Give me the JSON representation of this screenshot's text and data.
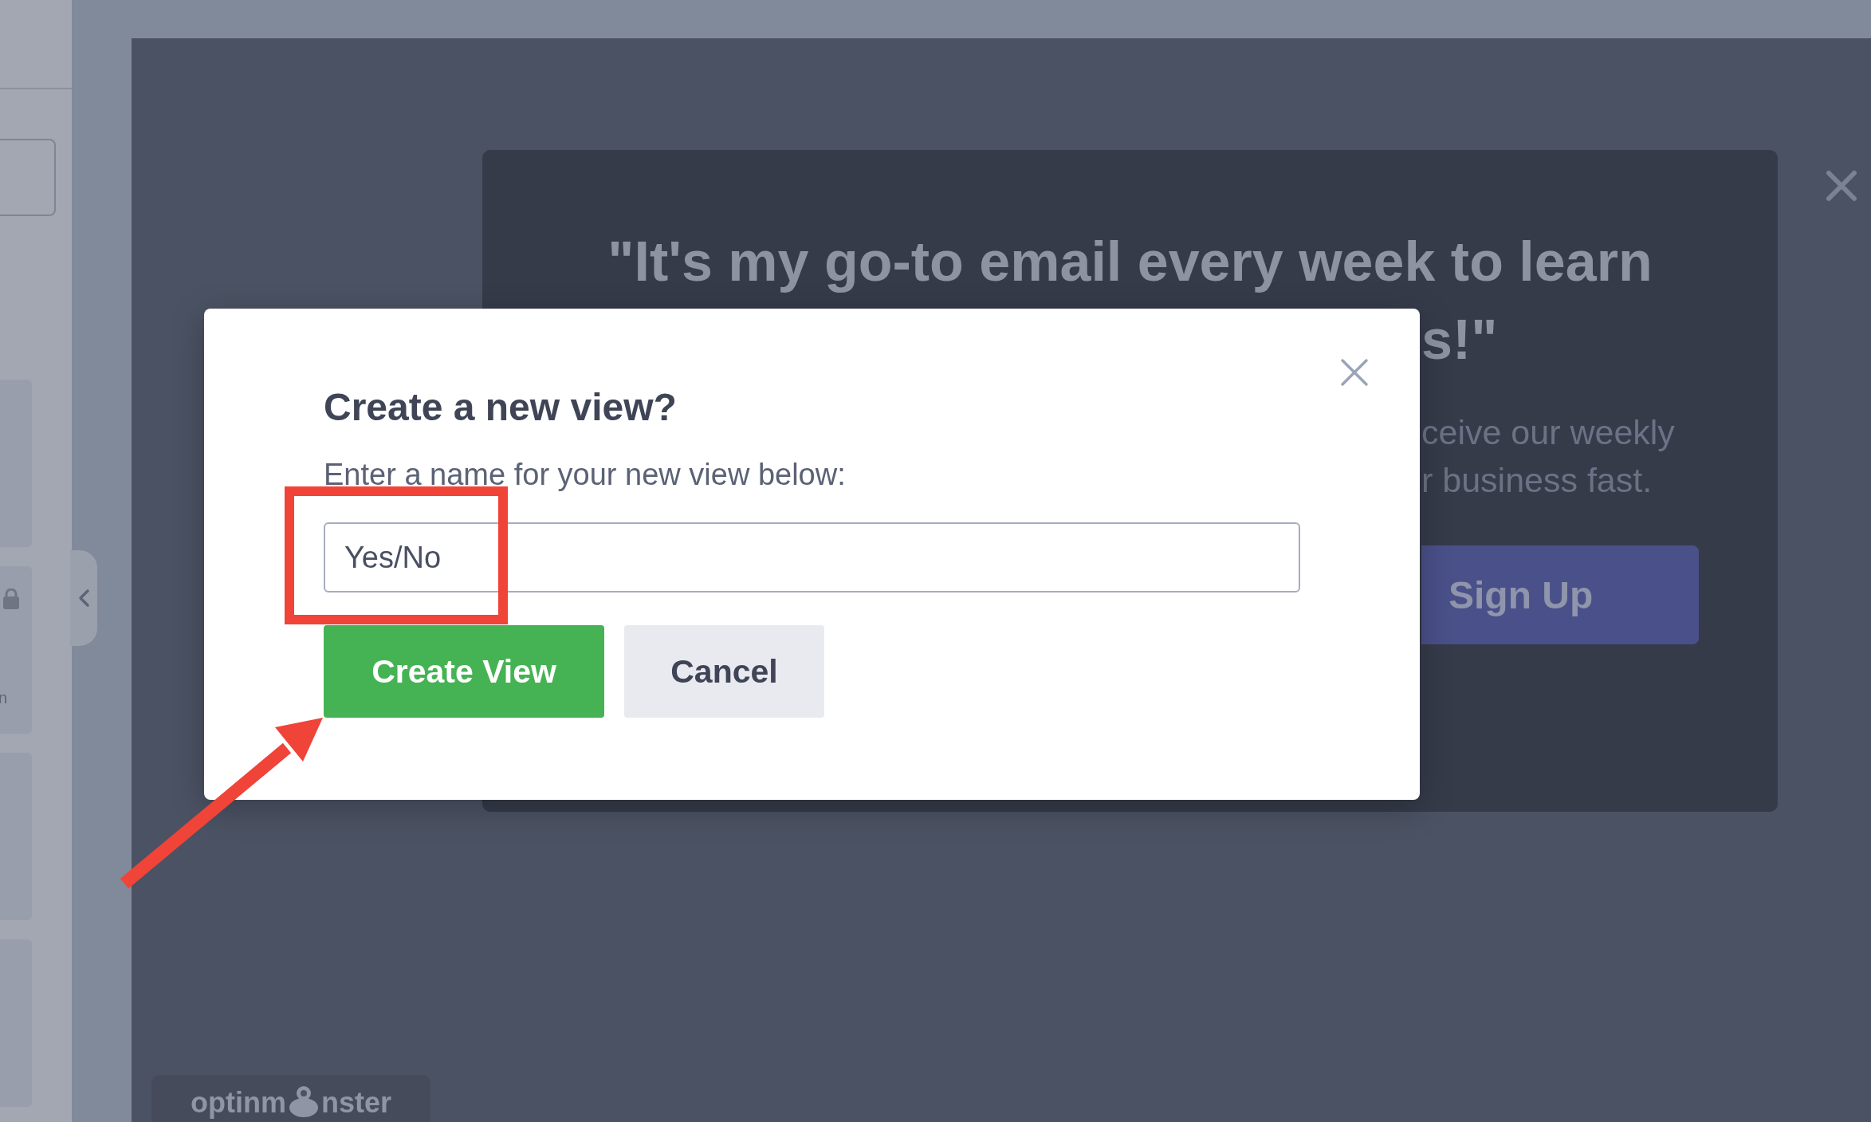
{
  "sidebar": {
    "cards": [
      {
        "locked": false
      },
      {
        "locked": true,
        "text": "n"
      },
      {
        "locked": false
      },
      {
        "locked": false
      }
    ]
  },
  "popup": {
    "headline_lines": [
      "\"It's my go-to email every week to learn",
      "s!\""
    ],
    "body_lines": [
      "ceive our weekly",
      "r business fast."
    ],
    "button": "Sign Up"
  },
  "modal": {
    "title": "Create a new view?",
    "label": "Enter a name for your new view below:",
    "input_value": "Yes/No",
    "buttons": [
      {
        "kind": "primary",
        "label": "Create View"
      },
      {
        "kind": "secondary",
        "label": "Cancel"
      }
    ]
  },
  "logo": {
    "text_before": "optinm",
    "text_after": "nster"
  },
  "annotations": {
    "highlight_box": true,
    "arrow": true
  }
}
